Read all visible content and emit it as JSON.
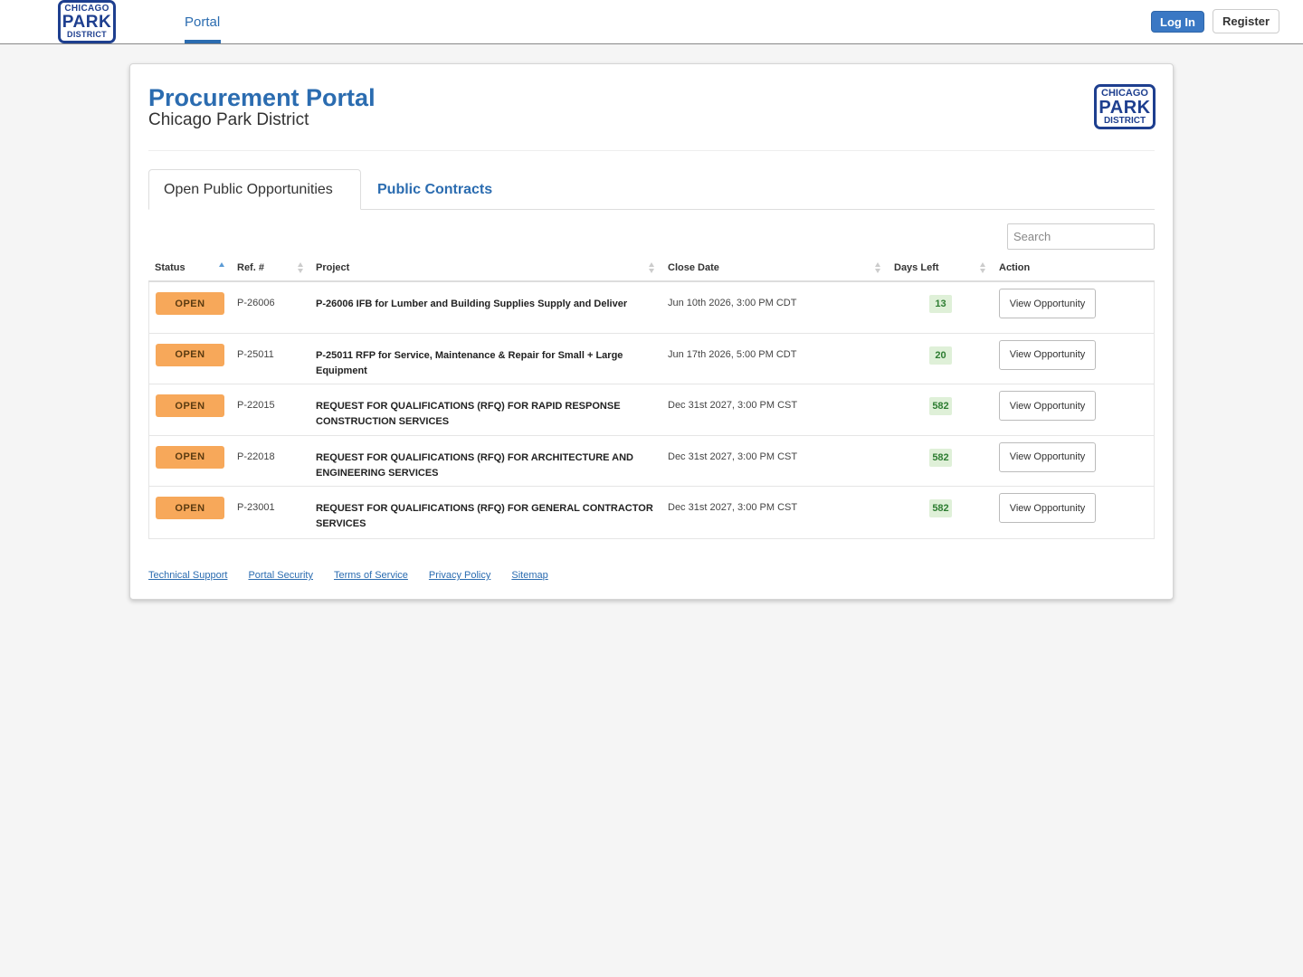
{
  "navbar": {
    "logo": {
      "line1": "CHICAGO",
      "line2": "PARK",
      "line3": "DISTRICT"
    },
    "tab_label": "Portal",
    "login_label": "Log In",
    "register_label": "Register"
  },
  "header": {
    "title": "Procurement Portal",
    "subtitle": "Chicago Park District",
    "logo": {
      "line1": "CHICAGO",
      "line2": "PARK",
      "line3": "DISTRICT"
    }
  },
  "tabs": [
    {
      "label": "Open Public Opportunities",
      "active": true
    },
    {
      "label": "Public Contracts",
      "active": false
    }
  ],
  "search": {
    "placeholder": "Search",
    "value": ""
  },
  "table": {
    "columns": [
      "Status",
      "Ref. #",
      "Project",
      "Close Date",
      "Days Left",
      "Action"
    ],
    "sort": {
      "column": "Status",
      "direction": "ascending"
    },
    "rows": [
      {
        "status": "OPEN",
        "ref": "P-26006",
        "project": "P-26006 IFB for Lumber and Building Supplies Supply and Deliver",
        "close_date": "Jun 10th 2026, 3:00 PM CDT",
        "days_left": "13",
        "action": "View Opportunity"
      },
      {
        "status": "OPEN",
        "ref": "P-25011",
        "project": "P-25011 RFP for Service, Maintenance & Repair for Small + Large Equipment",
        "close_date": "Jun 17th 2026, 5:00 PM CDT",
        "days_left": "20",
        "action": "View Opportunity"
      },
      {
        "status": "OPEN",
        "ref": "P-22015",
        "project": "REQUEST FOR QUALIFICATIONS (RFQ) FOR RAPID RESPONSE CONSTRUCTION SERVICES",
        "close_date": "Dec 31st 2027, 3:00 PM CST",
        "days_left": "582",
        "action": "View Opportunity"
      },
      {
        "status": "OPEN",
        "ref": "P-22018",
        "project": "REQUEST FOR QUALIFICATIONS (RFQ) FOR ARCHITECTURE AND ENGINEERING SERVICES",
        "close_date": "Dec 31st 2027, 3:00 PM CST",
        "days_left": "582",
        "action": "View Opportunity"
      },
      {
        "status": "OPEN",
        "ref": "P-23001",
        "project": "REQUEST FOR QUALIFICATIONS (RFQ) FOR GENERAL CONTRACTOR SERVICES",
        "close_date": "Dec 31st 2027, 3:00 PM CST",
        "days_left": "582",
        "action": "View Opportunity"
      }
    ]
  },
  "footer": {
    "links": [
      "Technical Support",
      "Portal Security",
      "Terms of Service",
      "Privacy Policy",
      "Sitemap"
    ]
  },
  "colors": {
    "brand_blue": "#2b6cb0",
    "logo_navy": "#1e3f8f",
    "login_button": "#3a78c4",
    "status_open": "#f7a85a",
    "days_left_bg": "#dff0d8",
    "days_left_text": "#2e7d32"
  },
  "icons": {
    "sort_ascending": "sort-asc-icon",
    "sort_unsorted": "sort-both-icon"
  }
}
